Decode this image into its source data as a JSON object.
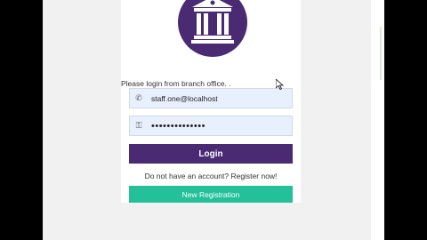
{
  "login": {
    "prompt": "Please login from branch office. .",
    "username_value": "staff.one@localhost",
    "password_value": "••••••••••••••",
    "login_label": "Login",
    "register_prompt": "Do not have an account? Register now!",
    "register_label": "New Registration"
  },
  "icons": {
    "logo": "bank-building-icon",
    "username": "phone-icon",
    "password": "key-icon"
  },
  "colors": {
    "logo_bg": "#4a2a73",
    "login_button": "#4a2a73",
    "register_button": "#23c09a",
    "field_bg": "#e8f0fe"
  }
}
